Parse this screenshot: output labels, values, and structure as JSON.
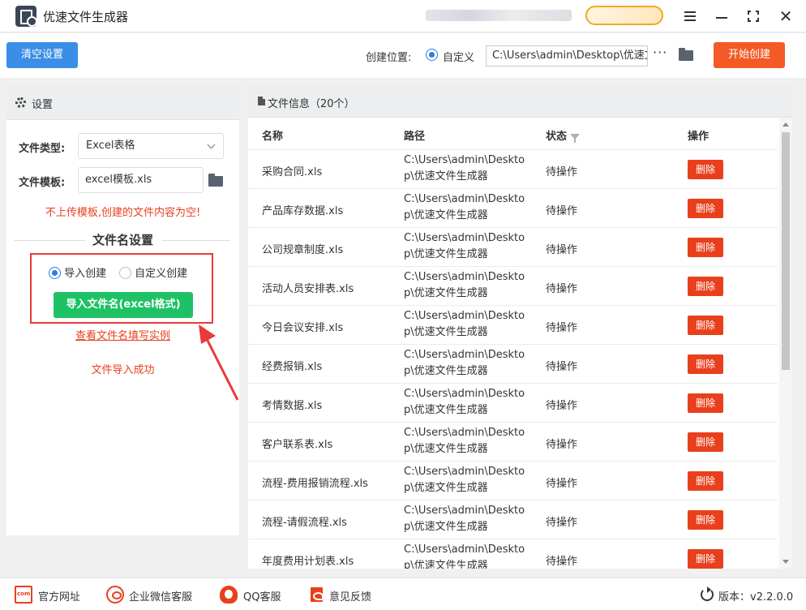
{
  "app": {
    "title": "优速文件生成器"
  },
  "toolbar": {
    "clear_label": "清空设置",
    "location_label": "创建位置:",
    "custom_label": "自定义",
    "path_value": "C:\\Users\\admin\\Desktop\\优速文件生成器",
    "more_label": "···",
    "start_label": "开始创建"
  },
  "settings": {
    "header": "设置",
    "file_type_label": "文件类型:",
    "file_type_value": "Excel表格",
    "template_label": "文件模板:",
    "template_value": "excel模板.xls",
    "warning": "不上传模板,创建的文件内容为空!",
    "section_title": "文件名设置",
    "option_import": "导入创建",
    "option_custom": "自定义创建",
    "import_button": "导入文件名(excel格式)",
    "example_link": "查看文件名填写实例",
    "success_msg": "文件导入成功"
  },
  "fileinfo": {
    "header": "文件信息（20个）",
    "columns": {
      "name": "名称",
      "path": "路径",
      "status": "状态",
      "action": "操作"
    },
    "delete_label": "删除",
    "rows": [
      {
        "name": "采购合同.xls",
        "path": "C:\\Users\\admin\\Desktop\\优速文件生成器",
        "status": "待操作"
      },
      {
        "name": "产品库存数据.xls",
        "path": "C:\\Users\\admin\\Desktop\\优速文件生成器",
        "status": "待操作"
      },
      {
        "name": "公司规章制度.xls",
        "path": "C:\\Users\\admin\\Desktop\\优速文件生成器",
        "status": "待操作"
      },
      {
        "name": "活动人员安排表.xls",
        "path": "C:\\Users\\admin\\Desktop\\优速文件生成器",
        "status": "待操作"
      },
      {
        "name": "今日会议安排.xls",
        "path": "C:\\Users\\admin\\Desktop\\优速文件生成器",
        "status": "待操作"
      },
      {
        "name": "经费报销.xls",
        "path": "C:\\Users\\admin\\Desktop\\优速文件生成器",
        "status": "待操作"
      },
      {
        "name": "考情数据.xls",
        "path": "C:\\Users\\admin\\Desktop\\优速文件生成器",
        "status": "待操作"
      },
      {
        "name": "客户联系表.xls",
        "path": "C:\\Users\\admin\\Desktop\\优速文件生成器",
        "status": "待操作"
      },
      {
        "name": "流程-费用报销流程.xls",
        "path": "C:\\Users\\admin\\Desktop\\优速文件生成器",
        "status": "待操作"
      },
      {
        "name": "流程-请假流程.xls",
        "path": "C:\\Users\\admin\\Desktop\\优速文件生成器",
        "status": "待操作"
      },
      {
        "name": "年度费用计划表.xls",
        "path": "C:\\Users\\admin\\Desktop\\优速文件生成器",
        "status": "待操作"
      }
    ]
  },
  "footer": {
    "website": "官方网址",
    "wechat": "企业微信客服",
    "qq": "QQ客服",
    "feedback": "意见反馈",
    "version": "版本：v2.2.0.0"
  },
  "colors": {
    "primary": "#3a8ee6",
    "start": "#f35a25",
    "green": "#1ec265",
    "alert": "#e8401c",
    "highlight": "#e83a3a"
  }
}
